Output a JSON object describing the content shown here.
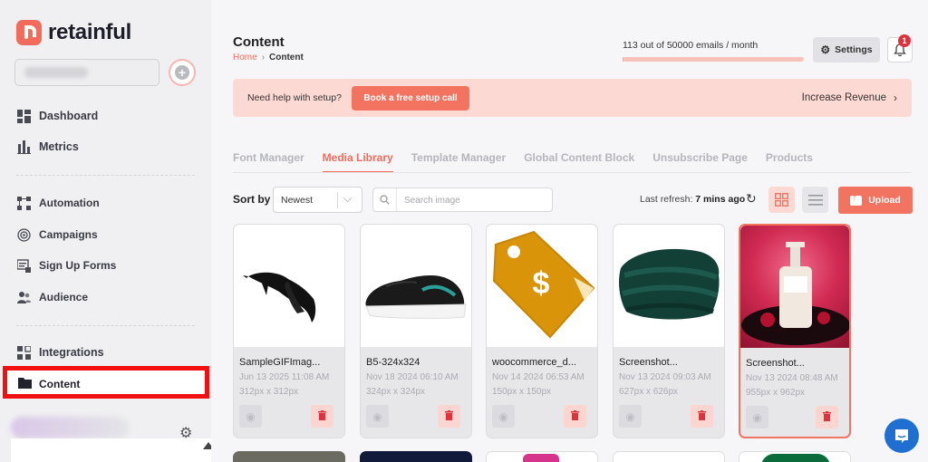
{
  "brand": {
    "name": "retainful"
  },
  "sidebar": {
    "add_store_icon": "plus-circle-icon",
    "items_top": [
      {
        "label": "Dashboard",
        "icon": "dashboard-icon"
      },
      {
        "label": "Metrics",
        "icon": "bar-chart-icon"
      }
    ],
    "items_mid": [
      {
        "label": "Automation",
        "icon": "automation-icon"
      },
      {
        "label": "Campaigns",
        "icon": "broadcast-icon"
      },
      {
        "label": "Sign Up Forms",
        "icon": "form-icon"
      },
      {
        "label": "Audience",
        "icon": "users-icon"
      }
    ],
    "items_bottom": [
      {
        "label": "Integrations",
        "icon": "integrations-icon"
      },
      {
        "label": "Content",
        "icon": "folder-icon",
        "active": true
      }
    ]
  },
  "header": {
    "title": "Content",
    "breadcrumb": {
      "home": "Home",
      "separator": "›",
      "current": "Content"
    },
    "usage_text": "113 out of 50000 emails / month",
    "usage_fraction": 0.00226,
    "settings_label": "Settings",
    "notification_count": "1"
  },
  "help_banner": {
    "text": "Need help with setup?",
    "button_label": "Book a free setup call",
    "link_label": "Increase Revenue",
    "link_chevron": "›"
  },
  "tabs": [
    {
      "label": "Font Manager",
      "active": false
    },
    {
      "label": "Media Library",
      "active": true
    },
    {
      "label": "Template Manager",
      "active": false
    },
    {
      "label": "Global Content Block",
      "active": false
    },
    {
      "label": "Unsubscribe Page",
      "active": false
    },
    {
      "label": "Products",
      "active": false
    }
  ],
  "toolbar": {
    "sort_label": "Sort by",
    "sort_value": "Newest",
    "search_placeholder": "Search image",
    "refresh_prefix": "Last refresh:",
    "refresh_value": "7 mins ago",
    "upload_label": "Upload"
  },
  "media": [
    {
      "name": "SampleGIFImag...",
      "date": "Jun 13 2025 11:08 AM",
      "dims": "312px x 312px",
      "thumb": "bird-image",
      "selected": false
    },
    {
      "name": "B5-324x324",
      "date": "Nov 18 2024 06:10 AM",
      "dims": "324px x 324px",
      "thumb": "sneaker-image",
      "selected": false
    },
    {
      "name": "woocommerce_d...",
      "date": "Nov 14 2024 06:53 AM",
      "dims": "150px x 150px",
      "thumb": "price-tag-image",
      "selected": false
    },
    {
      "name": "Screenshot...",
      "date": "Nov 13 2024 09:03 AM",
      "dims": "627px x 626px",
      "thumb": "blanket-image",
      "selected": false
    },
    {
      "name": "Screenshot...",
      "date": "Nov 13 2024 08:48 AM",
      "dims": "955px x 962px",
      "thumb": "lotion-image",
      "selected": true
    }
  ],
  "colors": {
    "accent": "#f26b5b",
    "highlight_border": "#f20f0f",
    "chat": "#1f6fd1"
  }
}
